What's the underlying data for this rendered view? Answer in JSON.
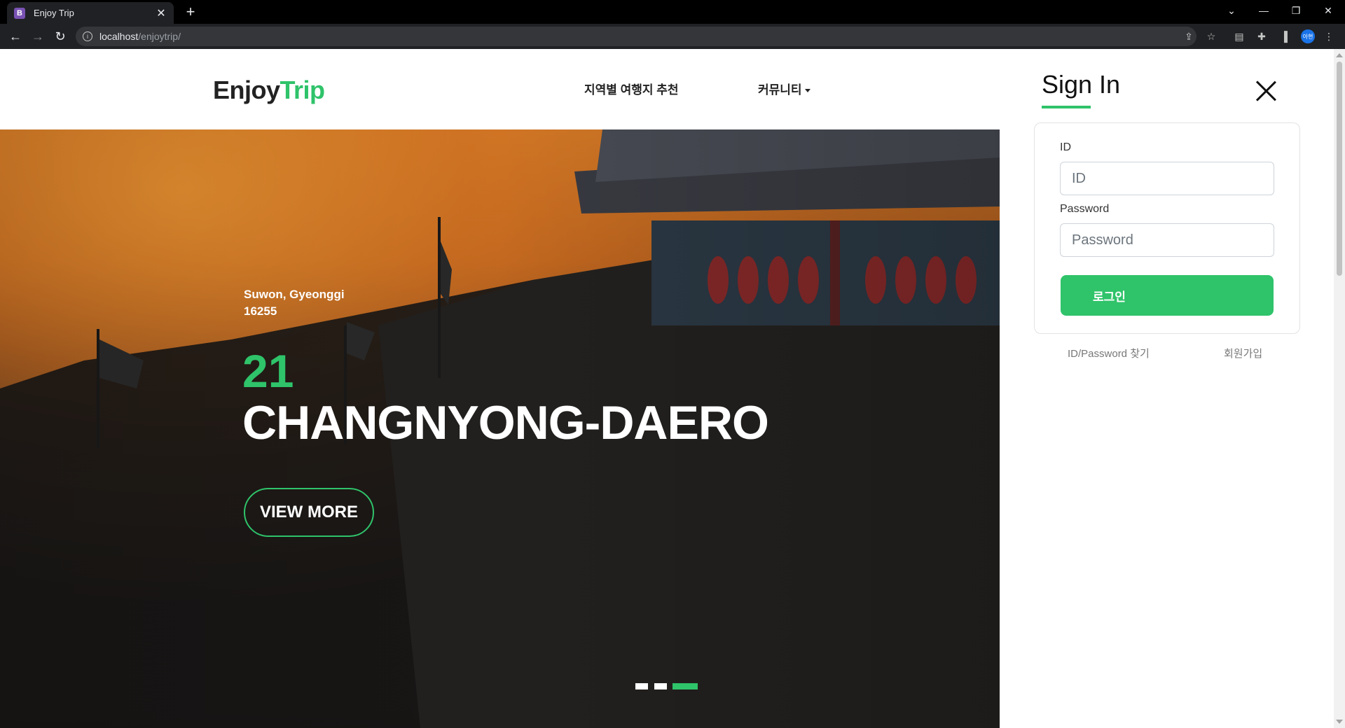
{
  "browser": {
    "tab_title": "Enjoy Trip",
    "favicon_letter": "B",
    "url_host": "localhost",
    "url_path": "/enjoytrip/",
    "profile_label": "아현"
  },
  "header": {
    "logo_part1": "Enjoy",
    "logo_part2": "Trip",
    "nav": [
      {
        "label": "지역별 여행지 추천"
      },
      {
        "label": "커뮤니티"
      }
    ]
  },
  "hero": {
    "address_line1": "Suwon, Gyeonggi",
    "address_line2": "16255",
    "number": "21",
    "street": "CHANGNYONG-DAERO",
    "button_label": "VIEW MORE",
    "active_slide": 3,
    "slide_count": 3
  },
  "signin": {
    "title": "Sign In",
    "id_label": "ID",
    "id_placeholder": "ID",
    "password_label": "Password",
    "password_placeholder": "Password",
    "login_button": "로그인",
    "find_link": "ID/Password 찾기",
    "signup_link": "회원가입"
  },
  "colors": {
    "accent": "#2fc36a",
    "chrome_dark": "#202124"
  }
}
